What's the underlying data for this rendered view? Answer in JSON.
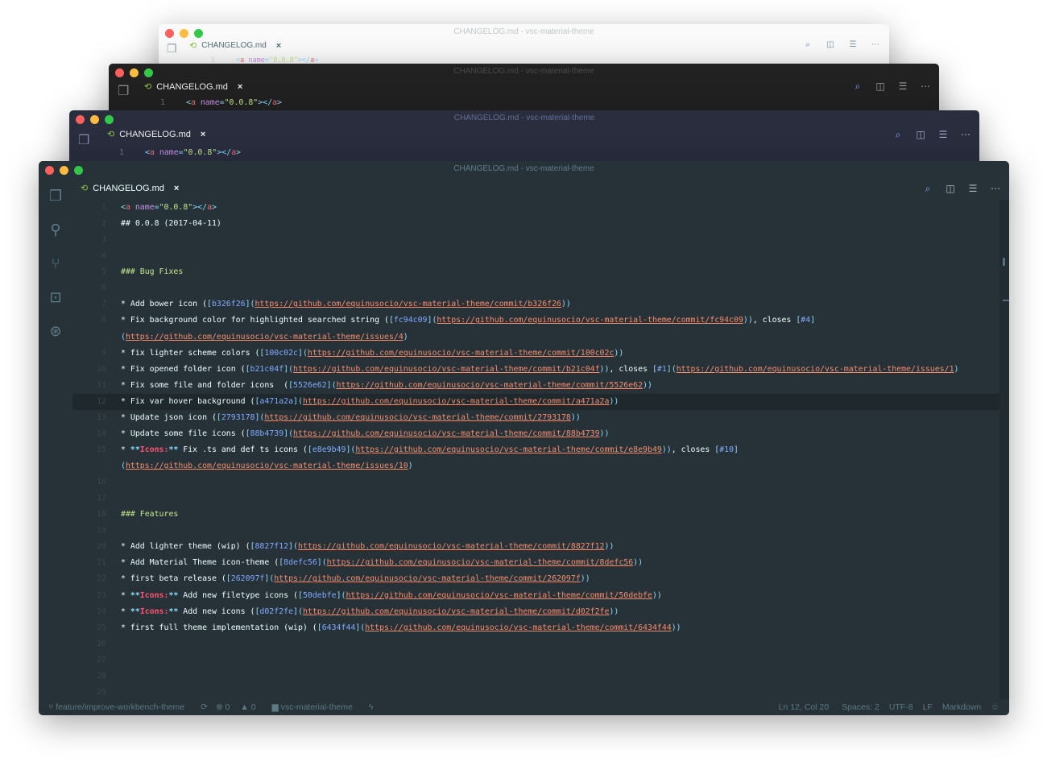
{
  "window_title": "CHANGELOG.md - vsc-material-theme",
  "tab": {
    "label": "CHANGELOG.md",
    "close": "×"
  },
  "line1_preview": [
    [
      "c",
      "<"
    ],
    [
      "r",
      "a"
    ],
    [
      "p",
      " "
    ],
    [
      "v",
      "name"
    ],
    [
      "c",
      "="
    ],
    [
      "g",
      "\"0.0.8\""
    ],
    [
      "c",
      "></"
    ],
    [
      "r",
      "a"
    ],
    [
      "c",
      ">"
    ]
  ],
  "themes": {
    "lighter": "#fafafa",
    "darker": "#212121",
    "palenight": "#292d3e",
    "default": "#263238"
  },
  "colors": {
    "tag": "#89ddff",
    "link": "#f78c6c",
    "hash": "#82aaff",
    "heading": "#c3e88d",
    "bold_red": "#ff5370",
    "attr": "#c792ea"
  },
  "activity_bar": [
    "files-icon",
    "search-icon",
    "source-control-icon",
    "extensions-icon",
    "debug-icon"
  ],
  "editor_actions": [
    "open-preview-icon",
    "split-editor-icon",
    "layout-icon",
    "more-icon"
  ],
  "editor": {
    "current_line": 12,
    "lines": [
      {
        "n": "1",
        "s": [
          [
            "c",
            "<"
          ],
          [
            "r",
            "a"
          ],
          [
            "p",
            " "
          ],
          [
            "v",
            "name"
          ],
          [
            "c",
            "="
          ],
          [
            "g",
            "\"0.0.8\""
          ],
          [
            "c",
            "></"
          ],
          [
            "r",
            "a"
          ],
          [
            "c",
            ">"
          ]
        ]
      },
      {
        "n": "2",
        "s": [
          [
            "p",
            "## 0.0.8 (2017-04-11)"
          ]
        ]
      },
      {
        "n": "3",
        "s": []
      },
      {
        "n": "4",
        "s": []
      },
      {
        "n": "5",
        "s": [
          [
            "g",
            "### Bug Fixes"
          ]
        ]
      },
      {
        "n": "6",
        "s": []
      },
      {
        "n": "7",
        "s": [
          [
            "p",
            "* Add bower icon ("
          ],
          [
            "c",
            "["
          ],
          [
            "h",
            "b326f26"
          ],
          [
            "c",
            "]("
          ],
          [
            "u",
            "https://github.com/equinusocio/vsc-material-theme/commit/b326f26"
          ],
          [
            "c",
            "))"
          ]
        ]
      },
      {
        "n": "8",
        "s": [
          [
            "p",
            "* Fix background color for highlighted searched string ("
          ],
          [
            "c",
            "["
          ],
          [
            "h",
            "fc94c09"
          ],
          [
            "c",
            "]("
          ],
          [
            "u",
            "https://github.com/equinusocio/vsc-material-theme/commit/fc94c09"
          ],
          [
            "c",
            "))"
          ],
          [
            "p",
            ", closes "
          ],
          [
            "c",
            "["
          ],
          [
            "h",
            "#4"
          ],
          [
            "c",
            "]"
          ]
        ]
      },
      {
        "n": "",
        "s": [
          [
            "c",
            "("
          ],
          [
            "u",
            "https://github.com/equinusocio/vsc-material-theme/issues/4"
          ],
          [
            "c",
            ")"
          ]
        ]
      },
      {
        "n": "9",
        "s": [
          [
            "p",
            "* fix lighter scheme colors ("
          ],
          [
            "c",
            "["
          ],
          [
            "h",
            "100c02c"
          ],
          [
            "c",
            "]("
          ],
          [
            "u",
            "https://github.com/equinusocio/vsc-material-theme/commit/100c02c"
          ],
          [
            "c",
            "))"
          ]
        ]
      },
      {
        "n": "10",
        "s": [
          [
            "p",
            "* Fix opened folder icon ("
          ],
          [
            "c",
            "["
          ],
          [
            "h",
            "b21c04f"
          ],
          [
            "c",
            "]("
          ],
          [
            "u",
            "https://github.com/equinusocio/vsc-material-theme/commit/b21c04f"
          ],
          [
            "c",
            "))"
          ],
          [
            "p",
            ", closes "
          ],
          [
            "c",
            "["
          ],
          [
            "h",
            "#1"
          ],
          [
            "c",
            "]("
          ],
          [
            "u",
            "https://github.com/equinusocio/vsc-material-theme/issues/1"
          ],
          [
            "c",
            ")"
          ]
        ]
      },
      {
        "n": "11",
        "s": [
          [
            "p",
            "* Fix some file and folder icons  ("
          ],
          [
            "c",
            "["
          ],
          [
            "h",
            "5526e62"
          ],
          [
            "c",
            "]("
          ],
          [
            "u",
            "https://github.com/equinusocio/vsc-material-theme/commit/5526e62"
          ],
          [
            "c",
            "))"
          ]
        ]
      },
      {
        "n": "12",
        "s": [
          [
            "p",
            "* Fix var hover background ("
          ],
          [
            "c",
            "["
          ],
          [
            "h",
            "a471a2a"
          ],
          [
            "c",
            "]("
          ],
          [
            "u",
            "https://github.com/equinusocio/vsc-material-theme/commit/a471a2a"
          ],
          [
            "c",
            "))"
          ]
        ]
      },
      {
        "n": "13",
        "s": [
          [
            "p",
            "* Update json icon ("
          ],
          [
            "c",
            "["
          ],
          [
            "h",
            "2793178"
          ],
          [
            "c",
            "]("
          ],
          [
            "u",
            "https://github.com/equinusocio/vsc-material-theme/commit/2793178"
          ],
          [
            "c",
            "))"
          ]
        ]
      },
      {
        "n": "14",
        "s": [
          [
            "p",
            "* Update some file icons ("
          ],
          [
            "c",
            "["
          ],
          [
            "h",
            "88b4739"
          ],
          [
            "c",
            "]("
          ],
          [
            "u",
            "https://github.com/equinusocio/vsc-material-theme/commit/88b4739"
          ],
          [
            "c",
            "))"
          ]
        ]
      },
      {
        "n": "15",
        "s": [
          [
            "p",
            "* "
          ],
          [
            "cb",
            "**"
          ],
          [
            "ir",
            "Icons:"
          ],
          [
            "cb",
            "**"
          ],
          [
            "p",
            " Fix .ts and def ts icons ("
          ],
          [
            "c",
            "["
          ],
          [
            "h",
            "e8e9b49"
          ],
          [
            "c",
            "]("
          ],
          [
            "u",
            "https://github.com/equinusocio/vsc-material-theme/commit/e8e9b49"
          ],
          [
            "c",
            "))"
          ],
          [
            "p",
            ", closes "
          ],
          [
            "c",
            "["
          ],
          [
            "h",
            "#10"
          ],
          [
            "c",
            "]"
          ]
        ]
      },
      {
        "n": "",
        "s": [
          [
            "c",
            "("
          ],
          [
            "u",
            "https://github.com/equinusocio/vsc-material-theme/issues/10"
          ],
          [
            "c",
            ")"
          ]
        ]
      },
      {
        "n": "16",
        "s": []
      },
      {
        "n": "17",
        "s": []
      },
      {
        "n": "18",
        "s": [
          [
            "g",
            "### Features"
          ]
        ]
      },
      {
        "n": "19",
        "s": []
      },
      {
        "n": "20",
        "s": [
          [
            "p",
            "* Add lighter theme (wip) ("
          ],
          [
            "c",
            "["
          ],
          [
            "h",
            "8827f12"
          ],
          [
            "c",
            "]("
          ],
          [
            "u",
            "https://github.com/equinusocio/vsc-material-theme/commit/8827f12"
          ],
          [
            "c",
            "))"
          ]
        ]
      },
      {
        "n": "21",
        "s": [
          [
            "p",
            "* Add Material Theme icon-theme ("
          ],
          [
            "c",
            "["
          ],
          [
            "h",
            "8defc56"
          ],
          [
            "c",
            "]("
          ],
          [
            "u",
            "https://github.com/equinusocio/vsc-material-theme/commit/8defc56"
          ],
          [
            "c",
            "))"
          ]
        ]
      },
      {
        "n": "22",
        "s": [
          [
            "p",
            "* first beta release ("
          ],
          [
            "c",
            "["
          ],
          [
            "h",
            "262097f"
          ],
          [
            "c",
            "]("
          ],
          [
            "u",
            "https://github.com/equinusocio/vsc-material-theme/commit/262097f"
          ],
          [
            "c",
            "))"
          ]
        ]
      },
      {
        "n": "23",
        "s": [
          [
            "p",
            "* "
          ],
          [
            "cb",
            "**"
          ],
          [
            "ir",
            "Icons:"
          ],
          [
            "cb",
            "**"
          ],
          [
            "p",
            " Add new filetype icons ("
          ],
          [
            "c",
            "["
          ],
          [
            "h",
            "50debfe"
          ],
          [
            "c",
            "]("
          ],
          [
            "u",
            "https://github.com/equinusocio/vsc-material-theme/commit/50debfe"
          ],
          [
            "c",
            "))"
          ]
        ]
      },
      {
        "n": "24",
        "s": [
          [
            "p",
            "* "
          ],
          [
            "cb",
            "**"
          ],
          [
            "ir",
            "Icons:"
          ],
          [
            "cb",
            "**"
          ],
          [
            "p",
            " Add new icons ("
          ],
          [
            "c",
            "["
          ],
          [
            "h",
            "d02f2fe"
          ],
          [
            "c",
            "]("
          ],
          [
            "u",
            "https://github.com/equinusocio/vsc-material-theme/commit/d02f2fe"
          ],
          [
            "c",
            "))"
          ]
        ]
      },
      {
        "n": "25",
        "s": [
          [
            "p",
            "* first full theme implementation (wip) ("
          ],
          [
            "c",
            "["
          ],
          [
            "h",
            "6434f44"
          ],
          [
            "c",
            "]("
          ],
          [
            "u",
            "https://github.com/equinusocio/vsc-material-theme/commit/6434f44"
          ],
          [
            "c",
            "))"
          ]
        ]
      },
      {
        "n": "26",
        "s": []
      },
      {
        "n": "27",
        "s": []
      },
      {
        "n": "28",
        "s": []
      },
      {
        "n": "29",
        "s": []
      }
    ]
  },
  "status": {
    "branch": "feature/improve-workbench-theme",
    "errors": "0",
    "warnings": "0",
    "folder": "vsc-material-theme",
    "position": "Ln 12, Col 20",
    "spaces": "Spaces: 2",
    "encoding": "UTF-8",
    "eol": "LF",
    "language": "Markdown"
  }
}
